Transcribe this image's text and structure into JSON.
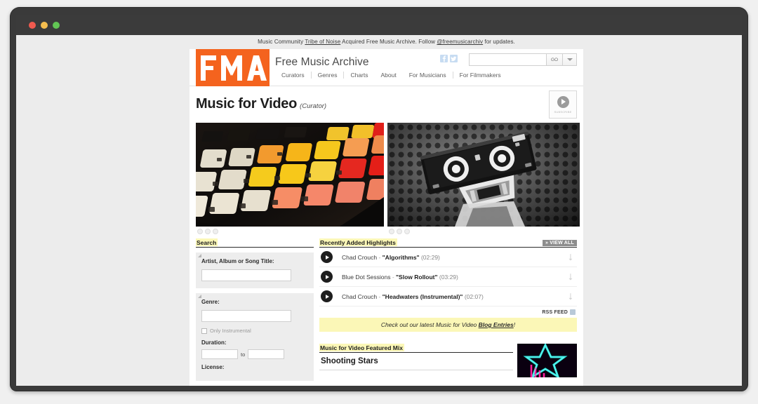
{
  "window": {
    "traffic_lights": [
      "close",
      "minimize",
      "zoom"
    ],
    "colors": {
      "close": "#f05a4f",
      "minimize": "#f5be4f",
      "zoom": "#62c554",
      "chrome": "#3b3b3b"
    }
  },
  "announcement": {
    "prefix": "Music Community ",
    "link1": "Tribe of Noise",
    "middle": " Acquired Free Music Archive. Follow ",
    "link2": "@freemusicarchiv",
    "suffix": " for updates."
  },
  "masthead": {
    "logo_text": "FMA",
    "logo_color": "#f4631e",
    "brand": "Free Music Archive",
    "social": [
      {
        "name": "facebook-icon",
        "label": "f"
      },
      {
        "name": "twitter-icon",
        "label": "t"
      }
    ],
    "search": {
      "value": "",
      "placeholder": "",
      "go_label": "GO"
    }
  },
  "nav": {
    "items": [
      {
        "label": "Curators"
      },
      {
        "label": "Genres"
      },
      {
        "label": "Charts"
      },
      {
        "label": "About"
      },
      {
        "label": "For Musicians"
      },
      {
        "label": "For Filmmakers"
      }
    ]
  },
  "page": {
    "title": "Music for Video",
    "subtitle": "(Curator)",
    "subscribe_label": "SUBSCRIBE"
  },
  "carousels": [
    {
      "name": "carousel-keyboard",
      "alt": "colorful editing keyboard keys",
      "dots": 3,
      "active_dot": 0
    },
    {
      "name": "carousel-videotape",
      "alt": "black and white mini DV videotape",
      "dots": 3,
      "active_dot": 0
    }
  ],
  "search_panel": {
    "heading": "Search",
    "facets": [
      {
        "label": "Artist, Album or Song Title:",
        "value": "",
        "placeholder": ""
      },
      {
        "label": "Genre:",
        "value": "",
        "placeholder": "",
        "checkbox_label": "Only Instrumental",
        "checkbox_checked": false,
        "duration_label": "Duration:",
        "duration_from": "",
        "duration_to": "",
        "duration_sep": "to",
        "license_label": "License:"
      }
    ]
  },
  "highlights": {
    "heading": "Recently Added Highlights",
    "view_all_label": "» VIEW ALL",
    "tracks": [
      {
        "artist": "Chad Crouch",
        "song": "\"Algorithms\"",
        "duration": "(02:29)"
      },
      {
        "artist": "Blue Dot Sessions",
        "song": "\"Slow Rollout\"",
        "duration": "(03:29)"
      },
      {
        "artist": "Chad Crouch",
        "song": "\"Headwaters (Instrumental)\"",
        "duration": "(02:07)"
      }
    ],
    "rss_label": "RSS FEED"
  },
  "notice": {
    "prefix": "Check out our latest Music for Video ",
    "link": "Blog Entries",
    "suffix": "!"
  },
  "featured": {
    "heading": "Music for Video Featured Mix",
    "title": "Shooting Stars",
    "thumb_alt": "neon star artwork"
  }
}
